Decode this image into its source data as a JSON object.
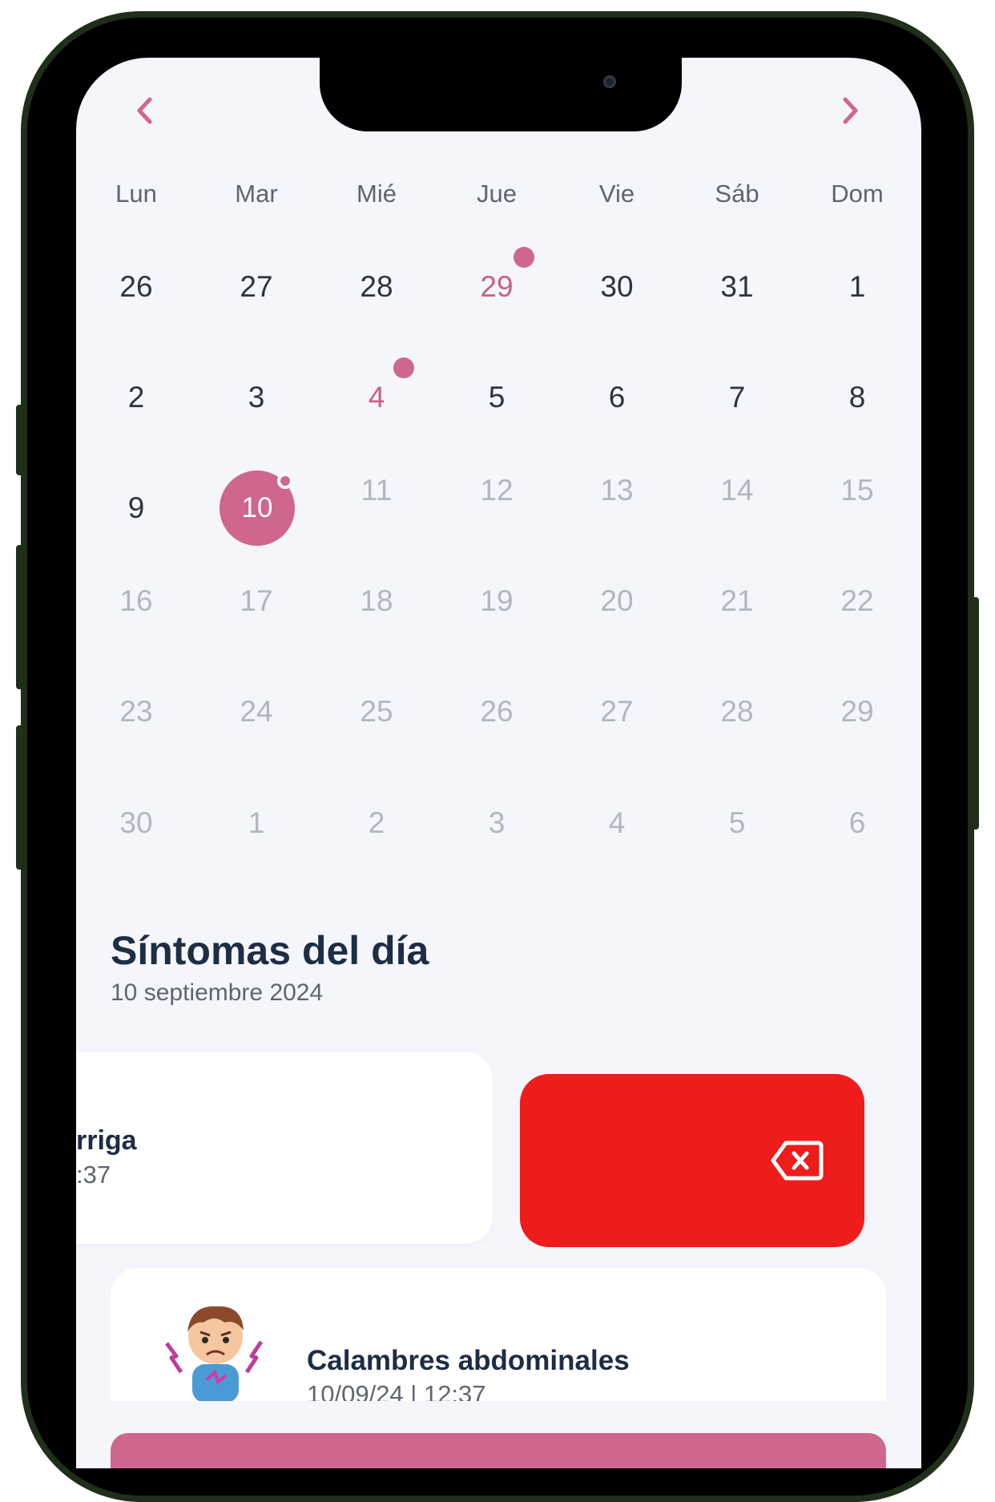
{
  "calendar": {
    "prev_icon": "chevron-left-icon",
    "next_icon": "chevron-right-icon",
    "weekdays": [
      "Lun",
      "Mar",
      "Mié",
      "Jue",
      "Vie",
      "Sáb",
      "Dom"
    ],
    "weeks": [
      [
        "26",
        "27",
        "28",
        "29",
        "30",
        "31",
        "1"
      ],
      [
        "2",
        "3",
        "4",
        "5",
        "6",
        "7",
        "8"
      ],
      [
        "9",
        "10",
        "11",
        "12",
        "13",
        "14",
        "15"
      ],
      [
        "16",
        "17",
        "18",
        "19",
        "20",
        "21",
        "22"
      ],
      [
        "23",
        "24",
        "25",
        "26",
        "27",
        "28",
        "29"
      ],
      [
        "30",
        "1",
        "2",
        "3",
        "4",
        "5",
        "6"
      ]
    ],
    "marked_days": [
      "29",
      "4"
    ],
    "selected_day": "10",
    "accent_color": "#cf6690"
  },
  "symptoms": {
    "title": "Síntomas del día",
    "date": "10 septiembre 2024",
    "swiped_item": {
      "name_visible": "rriga",
      "time_visible": ":37"
    },
    "delete_icon": "backspace-x-icon",
    "delete_color": "#ef1c1c",
    "items": [
      {
        "name": "Calambres abdominales",
        "time": "10/09/24 | 12:37",
        "icon": "stomach-cramp-avatar"
      }
    ]
  }
}
